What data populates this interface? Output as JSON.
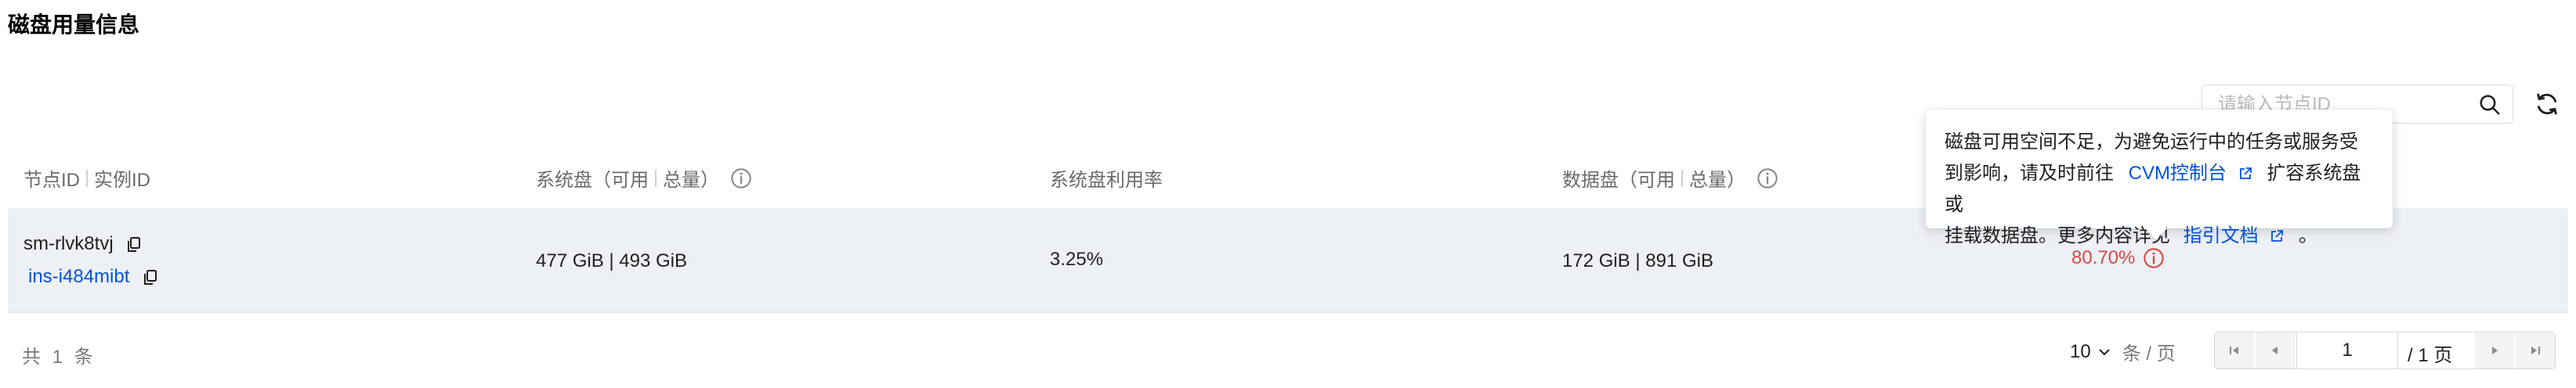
{
  "section_title": "磁盘用量信息",
  "search": {
    "placeholder": "请输入节点ID"
  },
  "table": {
    "columns": {
      "node": {
        "part1": "节点ID",
        "part2": "实例ID"
      },
      "system_disk": {
        "label": "系统盘（可用",
        "total": "总量）"
      },
      "system_usage": "系统盘利用率",
      "data_disk": {
        "label": "数据盘（可用",
        "total": "总量）"
      }
    },
    "rows": [
      {
        "node_id": "sm-rlvk8tvj",
        "instance_id": "ins-i484mibt",
        "system_disk": "477 GiB | 493 GiB",
        "system_usage": "3.25%",
        "data_disk": "172 GiB | 891 GiB",
        "data_usage": "80.70%"
      }
    ]
  },
  "tooltip": {
    "line1": "磁盘可用空间不足，为避免运行中的任务或服务受",
    "line2_pre": "到影响，请及时前往",
    "cvm_link": "CVM控制台",
    "line2_post": "扩容系统盘或",
    "line3_pre": "挂载数据盘。更多内容详见",
    "doc_link": "指引文档",
    "line3_post": "。"
  },
  "footer": {
    "total": "共 1 条",
    "page_size": "10",
    "page_size_unit": "条 / 页",
    "current_page": "1",
    "total_pages": "/ 1 页"
  },
  "colors": {
    "accent": "#0052d9",
    "warning": "#d54941",
    "row_bg": "#edf0f5"
  }
}
